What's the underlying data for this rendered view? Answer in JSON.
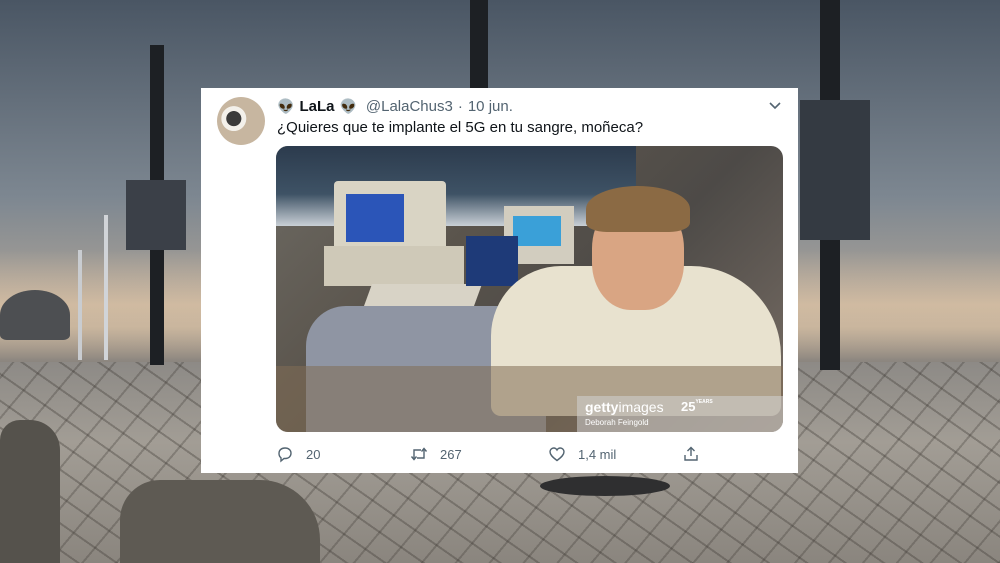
{
  "tweet": {
    "author_name": "LaLa",
    "handle": "@LalaChus3",
    "date": "10 jun.",
    "separator": "·",
    "text": "¿Quieres que te implante el 5G en tu sangre, moñeca?",
    "emoji_left": "👽",
    "emoji_right": "👽"
  },
  "image": {
    "brand_main": "getty",
    "brand_sub": "images",
    "credit": "Deborah Feingold",
    "anniversary": "25",
    "anniversary_suffix": "YEARS"
  },
  "actions": {
    "replies": "20",
    "retweets": "267",
    "likes": "1,4 mil"
  },
  "icons": [
    "alien-icon",
    "chevron-down-icon",
    "reply-icon",
    "retweet-icon",
    "like-icon",
    "share-icon"
  ],
  "colors": {
    "text": "#0f1419",
    "secondary": "#536471",
    "card": "#ffffff"
  }
}
